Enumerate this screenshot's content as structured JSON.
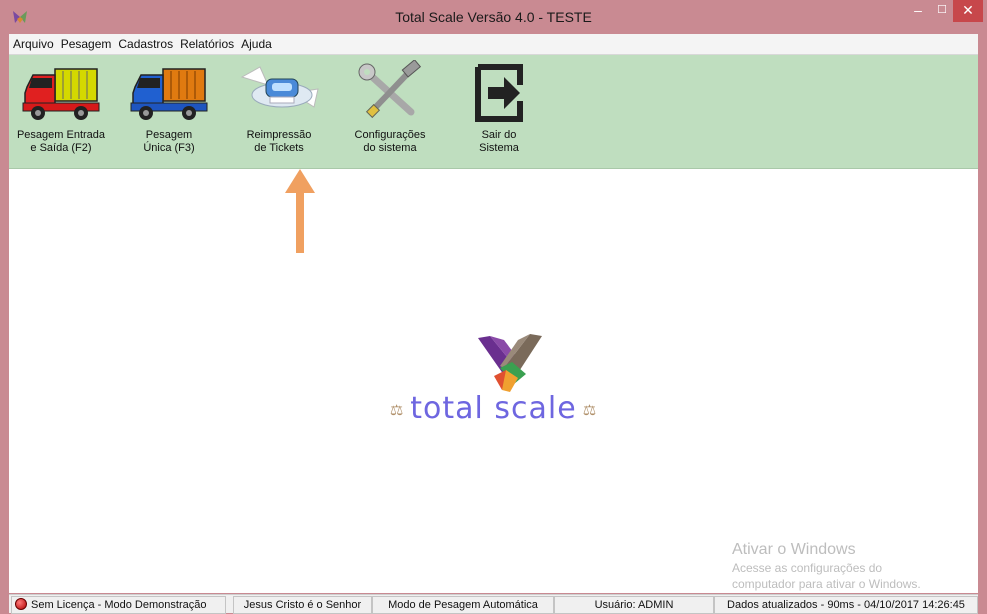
{
  "window": {
    "title": "Total Scale Versão 4.0  -  TESTE",
    "minimize": "–",
    "maximize": "☐",
    "close": "✕"
  },
  "menu": [
    "Arquivo",
    "Pesagem",
    "Cadastros",
    "Relatórios",
    "Ajuda"
  ],
  "toolbar": [
    {
      "label": "Pesagem Entrada\ne Saída (F2)",
      "icon": "red-truck-icon"
    },
    {
      "label": "Pesagem\n Única (F3)",
      "icon": "blue-truck-icon"
    },
    {
      "label": "Reimpressão\nde Tickets",
      "icon": "printer-icon"
    },
    {
      "label": "Configurações\ndo sistema",
      "icon": "tools-icon"
    },
    {
      "label": "Sair do\nSistema",
      "icon": "exit-icon"
    }
  ],
  "logo": {
    "text": "total scale",
    "left_icon": "⚖",
    "right_icon": "⚖"
  },
  "watermark": {
    "title": "Ativar o Windows",
    "line1": "Acesse as configurações do",
    "line2": "computador para ativar o Windows."
  },
  "status": {
    "license": "Sem Licença - Modo Demonstração",
    "motto": "Jesus Cristo é o Senhor",
    "mode": "Modo de Pesagem Automática",
    "user": "Usuário: ADMIN",
    "updated": "Dados atualizados - 90ms - 04/10/2017 14:26:45"
  },
  "colors": {
    "titlebar": "#c98a92",
    "toolbar": "#bfdebf",
    "logo_text": "#6e66e0",
    "arrow": "#f0a060",
    "close": "#c7474b"
  }
}
